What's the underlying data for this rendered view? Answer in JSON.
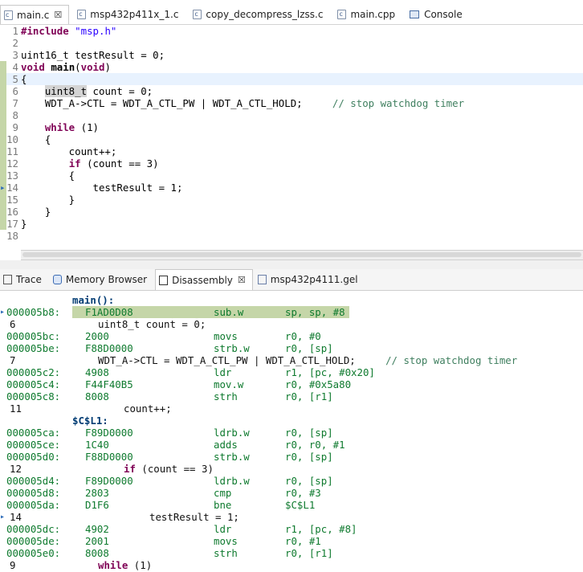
{
  "editor_tabs": [
    {
      "label": "main.c",
      "icon": "c-file-icon",
      "active": true,
      "closable": true
    },
    {
      "label": "msp432p411x_1.c",
      "icon": "c-file-icon"
    },
    {
      "label": "copy_decompress_lzss.c",
      "icon": "c-file-icon"
    },
    {
      "label": "main.cpp",
      "icon": "c-file-icon"
    },
    {
      "label": "Console",
      "icon": "console-icon"
    }
  ],
  "editor_lines": [
    {
      "n": "1",
      "parts": [
        {
          "t": "#include",
          "c": "kw"
        },
        {
          "t": " \"msp.h\"",
          "c": "str"
        }
      ]
    },
    {
      "n": "2",
      "parts": []
    },
    {
      "n": "3",
      "parts": [
        {
          "t": "uint16_t testResult = 0;"
        }
      ]
    },
    {
      "n": "4",
      "parts": [
        {
          "t": "void",
          "c": "kw"
        },
        {
          "t": " "
        },
        {
          "t": "main",
          "c": "b"
        },
        {
          "t": "("
        },
        {
          "t": "void",
          "c": "kw"
        },
        {
          "t": ")"
        }
      ]
    },
    {
      "n": "5",
      "parts": [
        {
          "t": "{"
        }
      ],
      "highlight": true
    },
    {
      "n": "6",
      "parts": [
        {
          "t": "    "
        },
        {
          "t": "uint8_t",
          "c": "typehl"
        },
        {
          "t": " count = 0;"
        }
      ]
    },
    {
      "n": "7",
      "parts": [
        {
          "t": "    WDT_A->CTL = WDT_A_CTL_PW | WDT_A_CTL_HOLD;     "
        },
        {
          "t": "// stop watchdog timer",
          "c": "cm"
        }
      ]
    },
    {
      "n": "8",
      "parts": []
    },
    {
      "n": "9",
      "parts": [
        {
          "t": "    "
        },
        {
          "t": "while",
          "c": "kw"
        },
        {
          "t": " (1)"
        }
      ]
    },
    {
      "n": "10",
      "parts": [
        {
          "t": "    {"
        }
      ]
    },
    {
      "n": "11",
      "parts": [
        {
          "t": "        count++;"
        }
      ]
    },
    {
      "n": "12",
      "parts": [
        {
          "t": "        "
        },
        {
          "t": "if",
          "c": "kw"
        },
        {
          "t": " (count == 3)"
        }
      ]
    },
    {
      "n": "13",
      "parts": [
        {
          "t": "        {"
        }
      ]
    },
    {
      "n": "14",
      "parts": [
        {
          "t": "            testResult = 1;"
        }
      ],
      "marker": true
    },
    {
      "n": "15",
      "parts": [
        {
          "t": "        }"
        }
      ]
    },
    {
      "n": "16",
      "parts": [
        {
          "t": "    }"
        }
      ]
    },
    {
      "n": "17",
      "parts": [
        {
          "t": "}"
        }
      ]
    },
    {
      "n": "18",
      "parts": []
    }
  ],
  "bottom_tabs": [
    {
      "label": "Trace",
      "icon": "trace-icon"
    },
    {
      "label": "Memory Browser",
      "icon": "memory-icon"
    },
    {
      "label": "Disassembly",
      "icon": "disassembly-icon",
      "active": true,
      "closable": true
    },
    {
      "label": "msp432p4111.gel",
      "icon": "gel-file-icon"
    }
  ],
  "disassembly": [
    {
      "type": "label",
      "text": "main():"
    },
    {
      "type": "instr",
      "addr": "000005b8:",
      "opcode": "F1AD0D08",
      "mnemonic": "sub.w",
      "operands": "sp, sp, #8",
      "current": true
    },
    {
      "type": "src",
      "n": "6",
      "text": "uint8_t count = 0;",
      "indent": 122
    },
    {
      "type": "instr",
      "addr": "000005bc:",
      "opcode": "2000",
      "mnemonic": "movs",
      "operands": "r0, #0"
    },
    {
      "type": "instr",
      "addr": "000005be:",
      "opcode": "F88D0000",
      "mnemonic": "strb.w",
      "operands": "r0, [sp]"
    },
    {
      "type": "src",
      "n": "7",
      "text": "WDT_A->CTL = WDT_A_CTL_PW | WDT_A_CTL_HOLD;     ",
      "comment": "// stop watchdog timer",
      "indent": 122
    },
    {
      "type": "instr",
      "addr": "000005c2:",
      "opcode": "4908",
      "mnemonic": "ldr",
      "operands": "r1, [pc, #0x20]"
    },
    {
      "type": "instr",
      "addr": "000005c4:",
      "opcode": "F44F40B5",
      "mnemonic": "mov.w",
      "operands": "r0, #0x5a80"
    },
    {
      "type": "instr",
      "addr": "000005c8:",
      "opcode": "8008",
      "mnemonic": "strh",
      "operands": "r0, [r1]"
    },
    {
      "type": "src",
      "n": "11",
      "text": "count++;",
      "indent": 154
    },
    {
      "type": "label",
      "text": "$C$L1:"
    },
    {
      "type": "instr",
      "addr": "000005ca:",
      "opcode": "F89D0000",
      "mnemonic": "ldrb.w",
      "operands": "r0, [sp]"
    },
    {
      "type": "instr",
      "addr": "000005ce:",
      "opcode": "1C40",
      "mnemonic": "adds",
      "operands": "r0, r0, #1"
    },
    {
      "type": "instr",
      "addr": "000005d0:",
      "opcode": "F88D0000",
      "mnemonic": "strb.w",
      "operands": "r0, [sp]"
    },
    {
      "type": "src",
      "n": "12",
      "kw": "if",
      "text": " (count == 3)",
      "indent": 154
    },
    {
      "type": "instr",
      "addr": "000005d4:",
      "opcode": "F89D0000",
      "mnemonic": "ldrb.w",
      "operands": "r0, [sp]"
    },
    {
      "type": "instr",
      "addr": "000005d8:",
      "opcode": "2803",
      "mnemonic": "cmp",
      "operands": "r0, #3"
    },
    {
      "type": "instr",
      "addr": "000005da:",
      "opcode": "D1F6",
      "mnemonic": "bne",
      "operands": "$C$L1"
    },
    {
      "type": "src",
      "n": "14",
      "text": "testResult = 1;",
      "indent": 186,
      "marker": true
    },
    {
      "type": "instr",
      "addr": "000005dc:",
      "opcode": "4902",
      "mnemonic": "ldr",
      "operands": "r1, [pc, #8]"
    },
    {
      "type": "instr",
      "addr": "000005de:",
      "opcode": "2001",
      "mnemonic": "movs",
      "operands": "r0, #1"
    },
    {
      "type": "instr",
      "addr": "000005e0:",
      "opcode": "8008",
      "mnemonic": "strh",
      "operands": "r0, [r1]"
    },
    {
      "type": "src",
      "n": "9",
      "kw": "while",
      "text": " (1)",
      "indent": 122
    }
  ],
  "colors": {
    "accent": "#c5d6a8",
    "keyword": "#7f0055",
    "string": "#2a00ff",
    "comment": "#3f7f5f",
    "address": "#0e7a2e"
  }
}
